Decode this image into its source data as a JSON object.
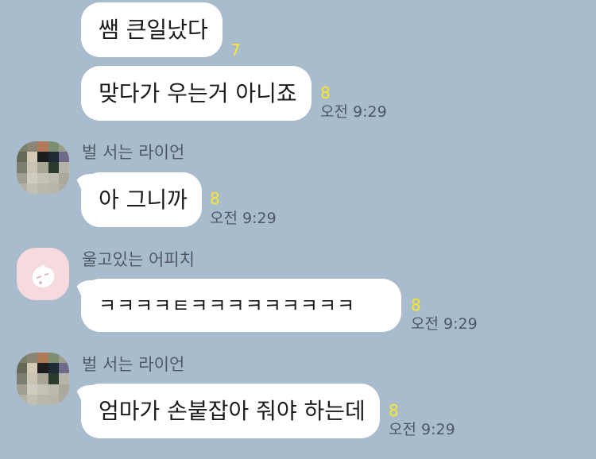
{
  "chat": {
    "messages": [
      {
        "text": "쌤 큰일났다",
        "read_count": "7"
      },
      {
        "text": "맞다가 우는거 아니죠",
        "read_count": "8",
        "time": "오전 9:29"
      },
      {
        "sender": "벌 서는 라이언",
        "text": "아 그니까",
        "read_count": "8",
        "time": "오전 9:29"
      },
      {
        "sender": "울고있는 어피치",
        "text": "ㅋㅋㅋㅋㅌㅋㅋㅋㅋㅋㅋㅋㅋㅋ",
        "read_count": "8",
        "time": "오전 9:29"
      },
      {
        "sender": "벌 서는 라이언",
        "text": "엄마가 손붙잡아 줘야 하는데",
        "read_count": "8",
        "time": "오전 9:29"
      }
    ]
  },
  "colors": {
    "background": "#a9bcce",
    "bubble": "#ffffff",
    "unread_count": "#fbe627",
    "timestamp": "#4d5864",
    "sender_name": "#505a66"
  }
}
